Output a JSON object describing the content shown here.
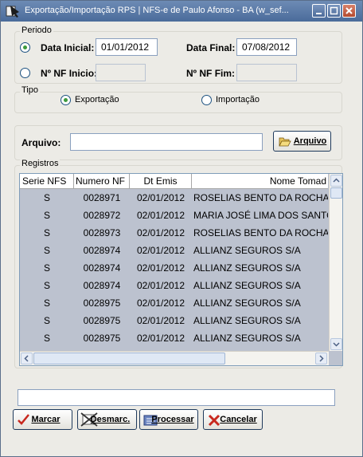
{
  "window": {
    "title": "Exportação/Importação RPS  |  NFS-e de Paulo Afonso - BA (w_sef..."
  },
  "periodo": {
    "group_label": "Periodo",
    "data_inicial_label": "Data Inicial:",
    "data_inicial_value": "01/01/2012",
    "data_final_label": "Data Final:",
    "data_final_value": "07/08/2012",
    "nf_inicio_label": "Nº NF Inicio:",
    "nf_fim_label": "Nº NF Fim:",
    "selected": "data"
  },
  "tipo": {
    "group_label": "Tipo",
    "exportacao_label": "Exportação",
    "importacao_label": "Importação",
    "selected": "exportacao"
  },
  "arquivo": {
    "label": "Arquivo:",
    "value": "",
    "button_label": "Arquivo"
  },
  "registros": {
    "group_label": "Registros",
    "columns": [
      "Serie NFS",
      "Numero NF",
      "Dt Emis",
      "Nome Tomad"
    ],
    "rows": [
      [
        "S",
        "0028971",
        "02/01/2012",
        "ROSELIAS BENTO DA ROCHA"
      ],
      [
        "S",
        "0028972",
        "02/01/2012",
        "MARIA JOSÉ LIMA DOS SANTOS"
      ],
      [
        "S",
        "0028973",
        "02/01/2012",
        "ROSELIAS BENTO DA ROCHA"
      ],
      [
        "S",
        "0028974",
        "02/01/2012",
        "ALLIANZ SEGUROS S/A"
      ],
      [
        "S",
        "0028974",
        "02/01/2012",
        "ALLIANZ SEGUROS S/A"
      ],
      [
        "S",
        "0028974",
        "02/01/2012",
        "ALLIANZ SEGUROS S/A"
      ],
      [
        "S",
        "0028975",
        "02/01/2012",
        "ALLIANZ SEGUROS S/A"
      ],
      [
        "S",
        "0028975",
        "02/01/2012",
        "ALLIANZ SEGUROS S/A"
      ],
      [
        "S",
        "0028975",
        "02/01/2012",
        "ALLIANZ SEGUROS S/A"
      ]
    ]
  },
  "status": {
    "value": ""
  },
  "actions": {
    "marcar": "Marcar",
    "desmarcar": "Desmarc.",
    "processar": "Processar",
    "cancelar": "Cancelar"
  },
  "colors": {
    "titlebar": "#4a6b9a",
    "grid_background": "#bcc2cf",
    "radio_on": "#3c9a3c",
    "cancel_icon": "#c8281e"
  }
}
